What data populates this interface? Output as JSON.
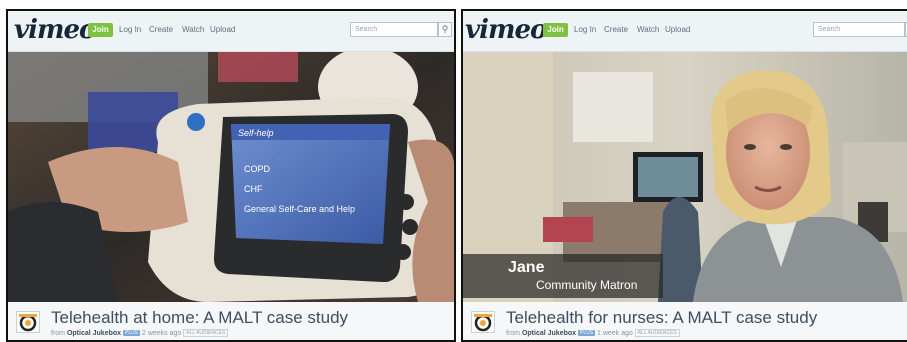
{
  "panels": [
    {
      "header": {
        "logo": "vimeo",
        "join_label": "Join",
        "nav": [
          "Log In",
          "Create",
          "Watch",
          "Upload"
        ],
        "search_placeholder": "Search"
      },
      "video": {
        "screen_title": "Self-help",
        "menu_items": [
          "COPD",
          "CHF",
          "General Self-Care and Help"
        ]
      },
      "info": {
        "title": "Telehealth at home: A MALT case study",
        "from_label": "from",
        "author": "Optical Jukebox",
        "badge": "PLUS",
        "time": "2 weeks ago",
        "badge2": "ALL AUDIENCES"
      }
    },
    {
      "header": {
        "logo": "vimeo",
        "join_label": "Join",
        "nav": [
          "Log In",
          "Create",
          "Watch",
          "Upload"
        ],
        "search_placeholder": "Search"
      },
      "video": {
        "lower_third_name": "Jane",
        "lower_third_role": "Community Matron"
      },
      "info": {
        "title": "Telehealth for nurses: A MALT case study",
        "from_label": "from",
        "author": "Optical Jukebox",
        "badge": "PLUS",
        "time": "1 week ago",
        "badge2": "ALL AUDIENCES"
      }
    }
  ],
  "colors": {
    "join_green": "#7fc242",
    "title_text": "#3e4f5e",
    "logo_navy": "#17273a"
  }
}
